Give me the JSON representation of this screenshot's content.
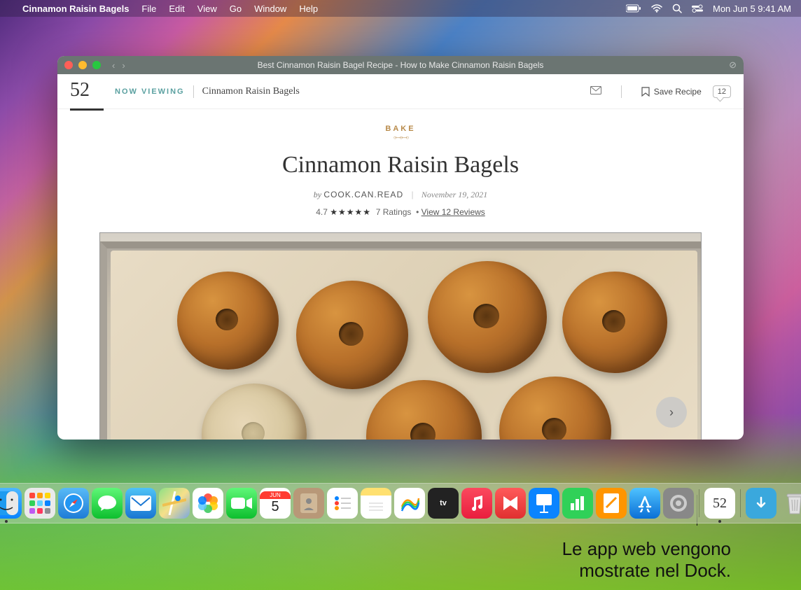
{
  "menubar": {
    "app_name": "Cinnamon Raisin Bagels",
    "items": [
      "File",
      "Edit",
      "View",
      "Go",
      "Window",
      "Help"
    ],
    "date_time": "Mon Jun 5  9:41 AM"
  },
  "window": {
    "title": "Best Cinnamon Raisin Bagel Recipe - How to Make Cinnamon Raisin Bagels",
    "brand": "52",
    "now_viewing_label": "NOW VIEWING",
    "breadcrumb": "Cinnamon Raisin Bagels",
    "save_label": "Save Recipe",
    "comment_count": "12",
    "category": "BAKE",
    "recipe_title": "Cinnamon Raisin Bagels",
    "by_label": "by",
    "author": "COOK.CAN.READ",
    "date": "November 19, 2021",
    "rating_value": "4.7",
    "stars": "★★★★★",
    "ratings_count": "7 Ratings",
    "reviews_link": "View 12 Reviews"
  },
  "dock": {
    "calendar_month": "JUN",
    "calendar_day": "5",
    "webapp_label": "52"
  },
  "caption": {
    "line1": "Le app web vengono",
    "line2": "mostrate nel Dock."
  }
}
